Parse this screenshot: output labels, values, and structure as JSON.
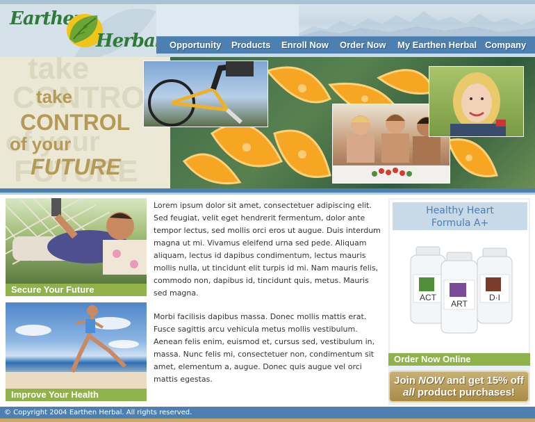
{
  "brand": {
    "line1": "Earthen",
    "line2": "Herbal"
  },
  "nav": {
    "items": [
      "Opportunity",
      "Products",
      "Enroll Now",
      "Order Now",
      "My Earthen Herbal",
      "Company"
    ]
  },
  "banner": {
    "tagline_1": "take",
    "tagline_2": "CONTROL",
    "tagline_3": "of your",
    "tagline_4": "FUTURE"
  },
  "promos": [
    {
      "label": "Secure Your Future"
    },
    {
      "label": "Improve Your Health"
    }
  ],
  "content": {
    "paragraph_1": "Lorem ipsum dolor sit amet, consectetuer adipiscing elit. Sed feugiat, velit eget hendrerit fermentum, dolor ante tempor lectus, sed mollis orci eros ut augue. Duis interdum magna ut mi. Vivamus eleifend urna sed pede. Aliquam aliquam, lectus id dapibus condimentum, lectus mauris mollis nulla, ut tincidunt elit turpis id mi. Nam mauris felis, commodo non, dapibus id, tincidunt quis, metus. Mauris sed magna.",
    "paragraph_2": "Morbi facilisis dapibus massa. Donec mollis mattis erat. Fusce sagittis arcu vehicula metus mollis vestibulum. Aenean felis enim, euismod et, cursus sed, vestibulum in, massa. Nunc felis mi, consectetuer non, condimentum sit amet, elementum a, augue. Donec quis augue vel orci mattis egestas."
  },
  "product": {
    "title_line1": "Healthy Heart",
    "title_line2": "Formula A+",
    "bottles": [
      "ACT",
      "ART",
      "D·I"
    ]
  },
  "order_online": "Order Now Online",
  "join": {
    "word_join": "Join",
    "word_now": "NOW",
    "rest_line1": "and get 15% off",
    "word_all": "all",
    "rest_line2": "product purchases!"
  },
  "footer": {
    "copyright": "© Copyright 2004 Earthen Herbal. All rights reserved."
  },
  "colors": {
    "nav_blue": "#4d7fb0",
    "green": "#8fb34a",
    "gold": "#b59a55",
    "logo_green": "#2f7a3a"
  }
}
